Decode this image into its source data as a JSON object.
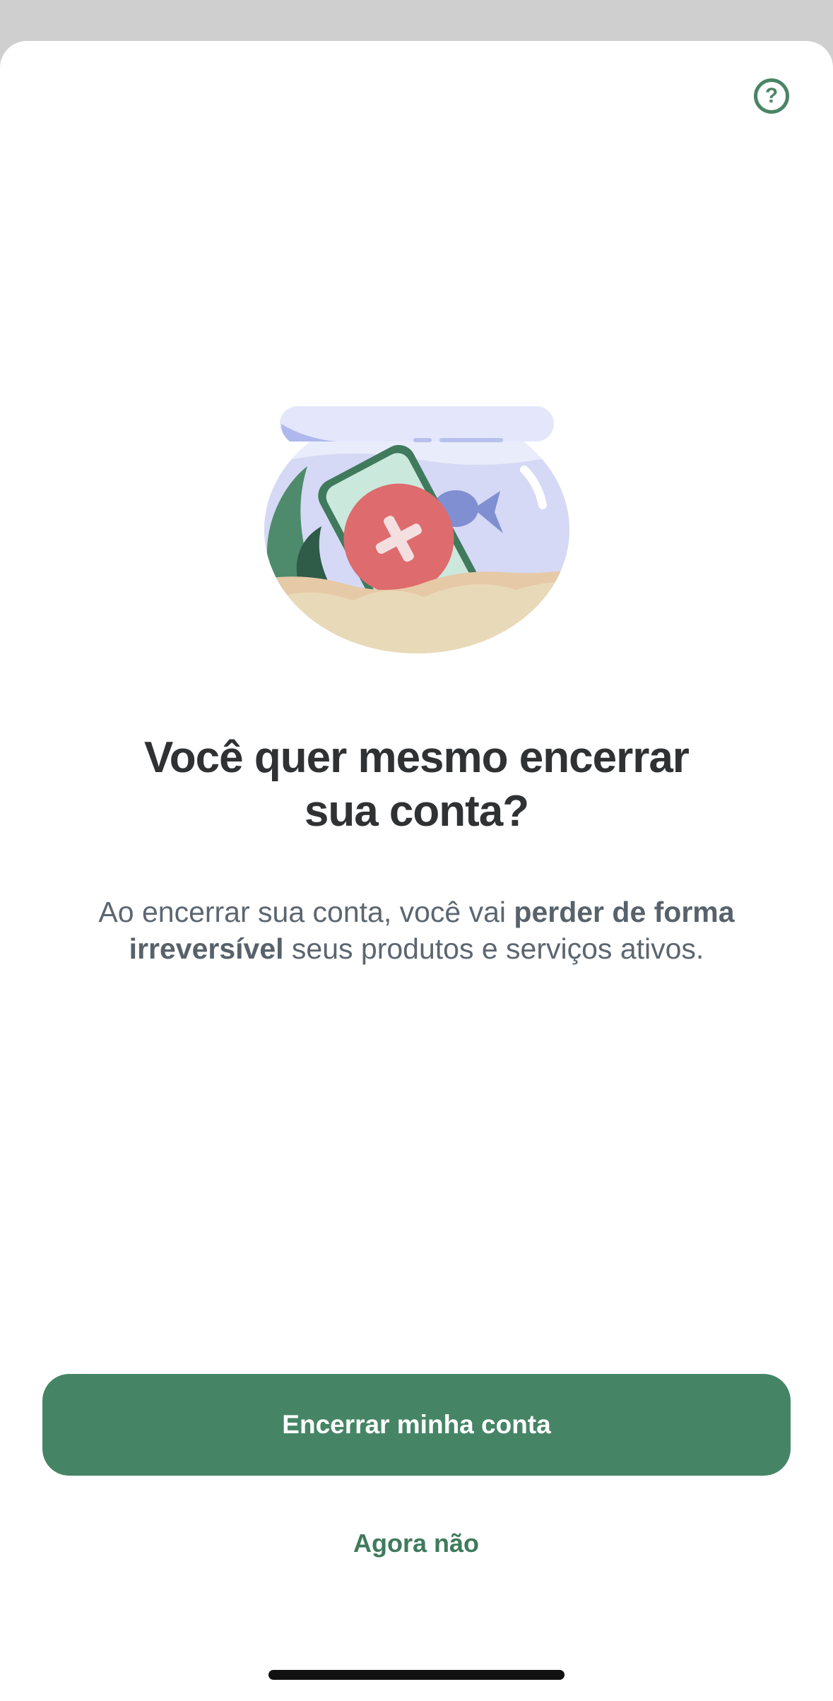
{
  "help": {
    "icon": "question-circle-icon",
    "glyph": "?"
  },
  "illustration": {
    "name": "fishbowl-phone-illustration"
  },
  "dialog": {
    "title_line1": "Você quer mesmo encerrar",
    "title_line2": "sua conta?",
    "desc_part1": "Ao encerrar sua conta, você vai ",
    "desc_bold": "perder de forma irreversível",
    "desc_part2": " seus produtos e serviços ativos."
  },
  "actions": {
    "primary_label": "Encerrar minha conta",
    "secondary_label": "Agora não"
  },
  "colors": {
    "accent": "#458565",
    "title": "#2f3133",
    "body": "#5c6670"
  }
}
